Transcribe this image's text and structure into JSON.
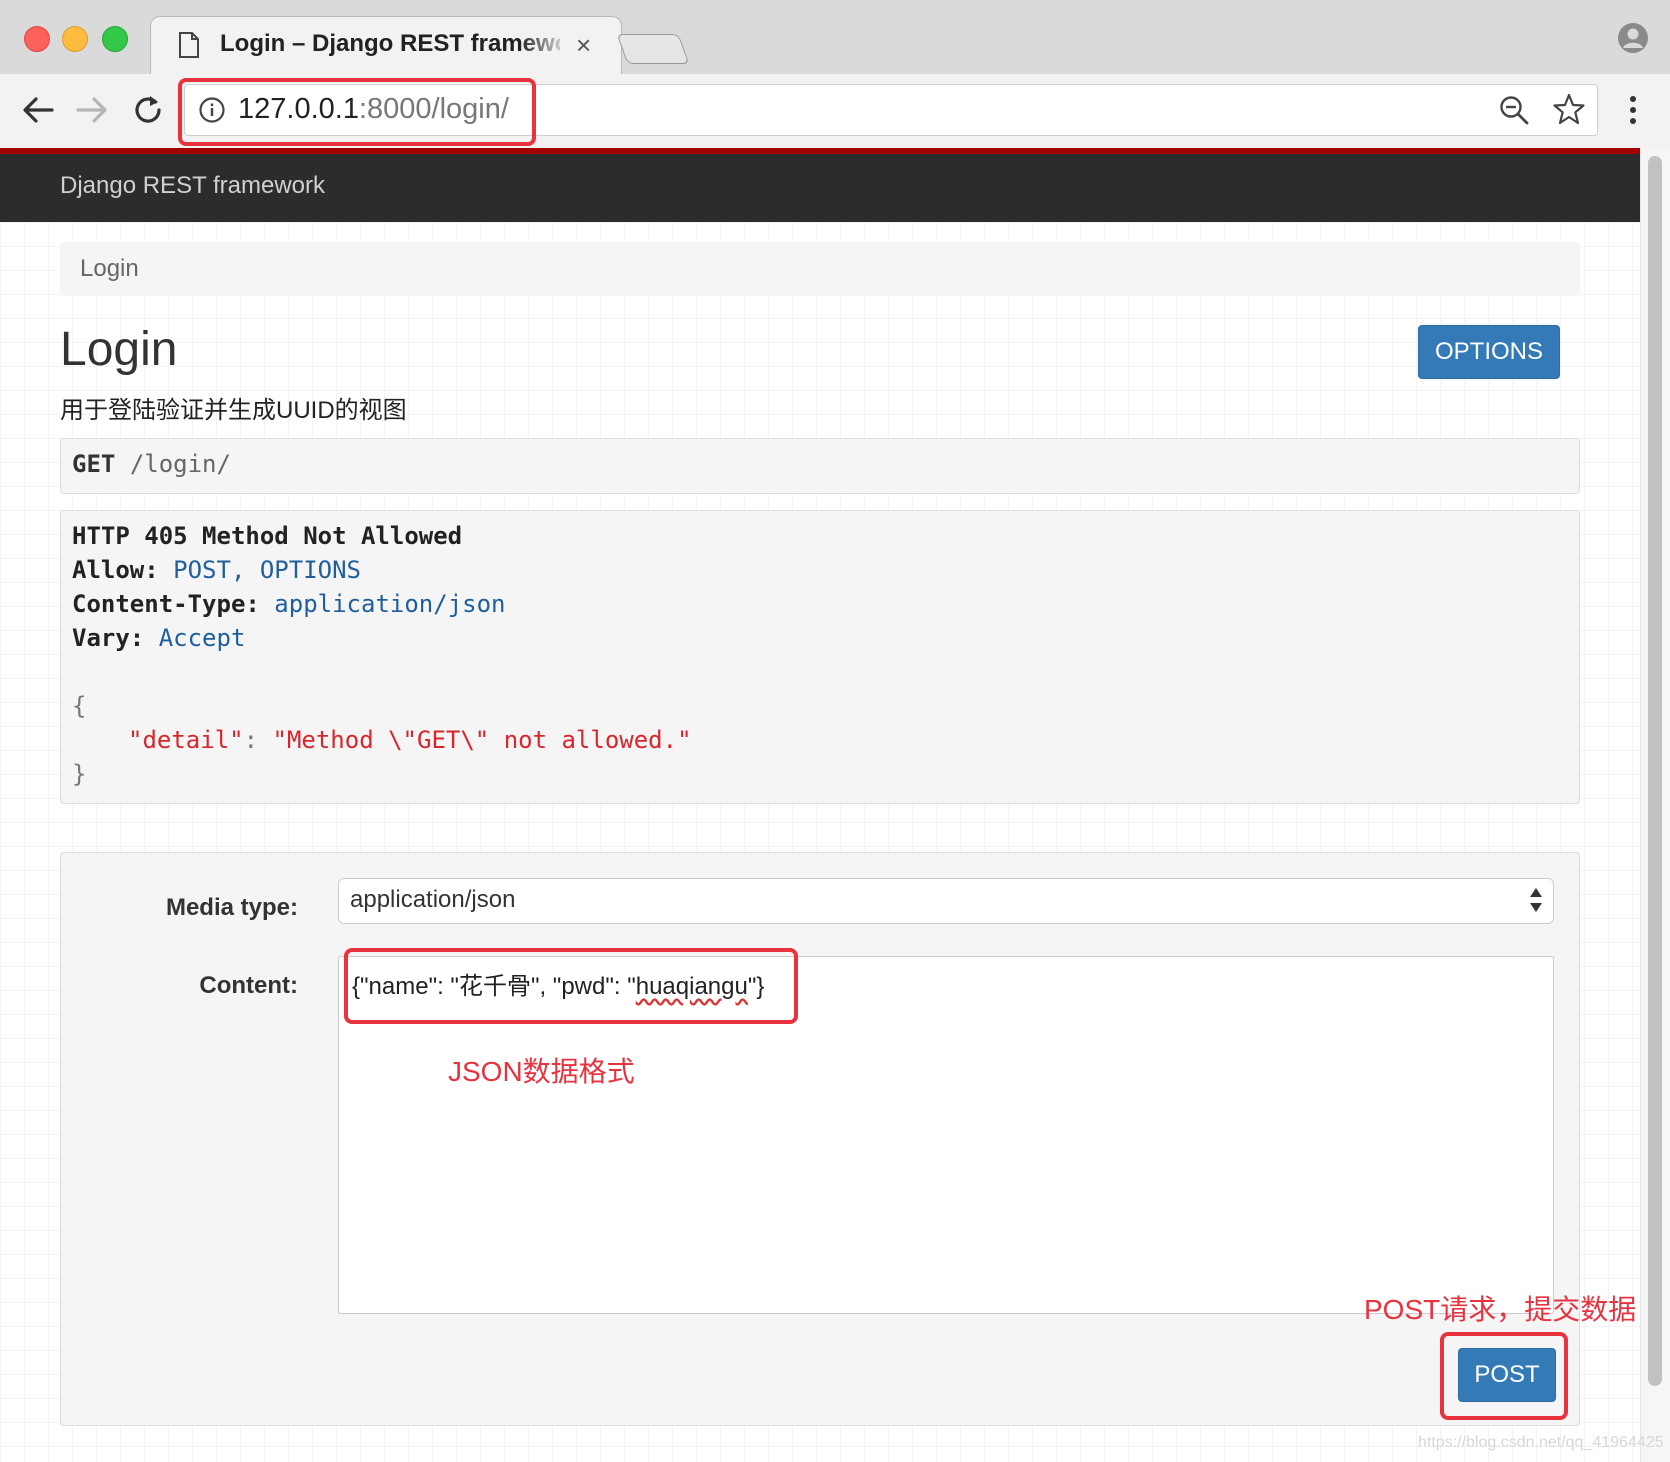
{
  "browser": {
    "tab_title": "Login – Django REST framework",
    "tab_close": "×",
    "url_host": "127.0.0.1",
    "url_rest": ":8000/login/"
  },
  "navbar": {
    "brand": "Django REST framework"
  },
  "breadcrumb": {
    "items": [
      "Login"
    ]
  },
  "page": {
    "title": "Login",
    "description": "用于登陆验证并生成UUID的视图",
    "options_label": "OPTIONS"
  },
  "request": {
    "method": "GET",
    "path": "/login/"
  },
  "response": {
    "status_line": "HTTP 405 Method Not Allowed",
    "headers": [
      {
        "key": "Allow:",
        "value": "POST, OPTIONS"
      },
      {
        "key": "Content-Type:",
        "value": "application/json"
      },
      {
        "key": "Vary:",
        "value": "Accept"
      }
    ],
    "body_open": "{",
    "body_key": "\"detail\"",
    "body_colon": ":",
    "body_value": "\"Method \\\"GET\\\" not allowed.\"",
    "body_close": "}"
  },
  "form": {
    "media_type_label": "Media type:",
    "media_type_value": "application/json",
    "content_label": "Content:",
    "content_prefix": "{\"name\": \"花千骨\", \"pwd\": \"",
    "content_underlined": "huaqiangu",
    "content_suffix": "\"}",
    "post_label": "POST"
  },
  "annotations": {
    "json_note": "JSON数据格式",
    "post_note": "POST请求，提交数据"
  },
  "watermark": "https://blog.csdn.net/qq_41964425",
  "colors": {
    "accent": "#337ab7",
    "annotation_red": "#e8333f",
    "navbar": "#2c2c2c",
    "json_string": "#d8262c",
    "header_value": "#1f5f9e"
  }
}
